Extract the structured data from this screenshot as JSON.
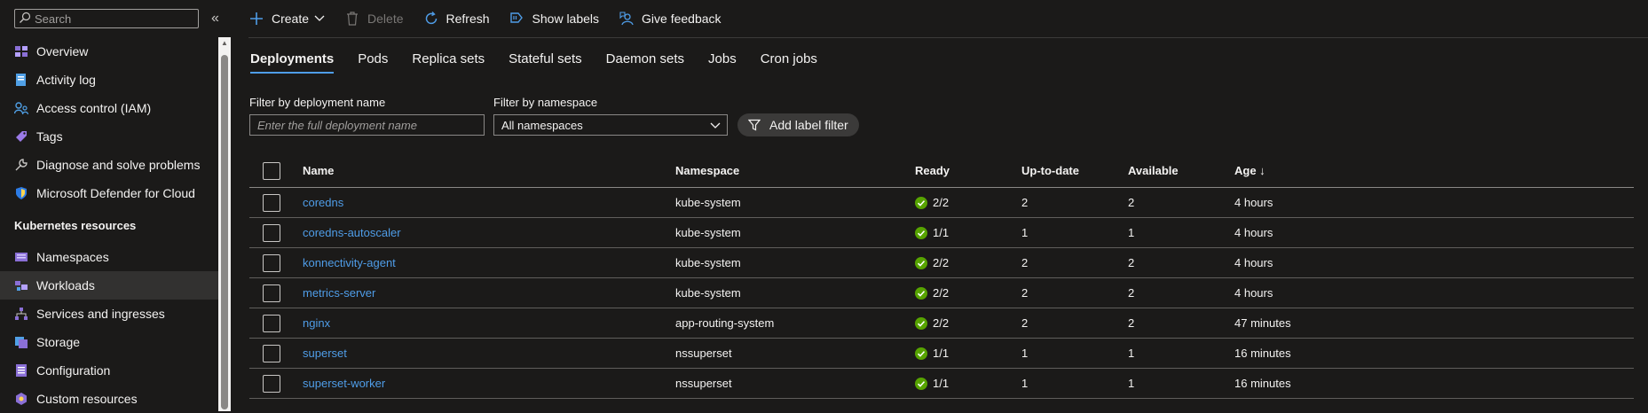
{
  "sidebar": {
    "search_placeholder": "Search",
    "collapse_glyph": "«",
    "items_top": [
      {
        "label": "Overview",
        "icon": "overview-icon"
      },
      {
        "label": "Activity log",
        "icon": "activity-log-icon"
      },
      {
        "label": "Access control (IAM)",
        "icon": "iam-icon"
      },
      {
        "label": "Tags",
        "icon": "tag-icon"
      },
      {
        "label": "Diagnose and solve problems",
        "icon": "wrench-icon"
      },
      {
        "label": "Microsoft Defender for Cloud",
        "icon": "shield-icon"
      }
    ],
    "section_title": "Kubernetes resources",
    "items_k8s": [
      {
        "label": "Namespaces",
        "icon": "namespaces-icon"
      },
      {
        "label": "Workloads",
        "icon": "workloads-icon",
        "active": true
      },
      {
        "label": "Services and ingresses",
        "icon": "services-icon"
      },
      {
        "label": "Storage",
        "icon": "storage-icon"
      },
      {
        "label": "Configuration",
        "icon": "configuration-icon"
      },
      {
        "label": "Custom resources",
        "icon": "custom-resources-icon"
      }
    ]
  },
  "toolbar": {
    "create": "Create",
    "delete": "Delete",
    "refresh": "Refresh",
    "show_labels": "Show labels",
    "give_feedback": "Give feedback"
  },
  "tabs": [
    {
      "label": "Deployments",
      "active": true
    },
    {
      "label": "Pods"
    },
    {
      "label": "Replica sets"
    },
    {
      "label": "Stateful sets"
    },
    {
      "label": "Daemon sets"
    },
    {
      "label": "Jobs"
    },
    {
      "label": "Cron jobs"
    }
  ],
  "filters": {
    "name_label": "Filter by deployment name",
    "name_placeholder": "Enter the full deployment name",
    "namespace_label": "Filter by namespace",
    "namespace_value": "All namespaces",
    "add_label_filter": "Add label filter"
  },
  "table": {
    "headers": {
      "name": "Name",
      "namespace": "Namespace",
      "ready": "Ready",
      "uptodate": "Up-to-date",
      "available": "Available",
      "age": "Age ↓"
    },
    "rows": [
      {
        "name": "coredns",
        "namespace": "kube-system",
        "ready": "2/2",
        "uptodate": "2",
        "available": "2",
        "age": "4 hours"
      },
      {
        "name": "coredns-autoscaler",
        "namespace": "kube-system",
        "ready": "1/1",
        "uptodate": "1",
        "available": "1",
        "age": "4 hours"
      },
      {
        "name": "konnectivity-agent",
        "namespace": "kube-system",
        "ready": "2/2",
        "uptodate": "2",
        "available": "2",
        "age": "4 hours"
      },
      {
        "name": "metrics-server",
        "namespace": "kube-system",
        "ready": "2/2",
        "uptodate": "2",
        "available": "2",
        "age": "4 hours"
      },
      {
        "name": "nginx",
        "namespace": "app-routing-system",
        "ready": "2/2",
        "uptodate": "2",
        "available": "2",
        "age": "47 minutes"
      },
      {
        "name": "superset",
        "namespace": "nssuperset",
        "ready": "1/1",
        "uptodate": "1",
        "available": "1",
        "age": "16 minutes"
      },
      {
        "name": "superset-worker",
        "namespace": "nssuperset",
        "ready": "1/1",
        "uptodate": "1",
        "available": "1",
        "age": "16 minutes"
      }
    ]
  },
  "colors": {
    "background": "#1b1a19",
    "link": "#4f9de8",
    "success": "#57a300",
    "accent_icon": "#8a6fd6"
  }
}
